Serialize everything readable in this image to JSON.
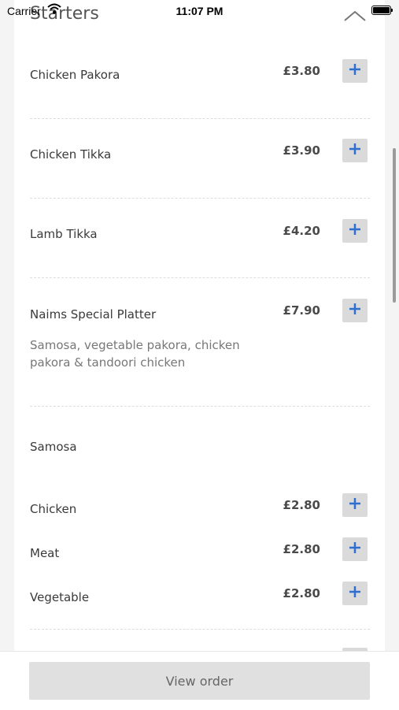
{
  "status_bar": {
    "carrier": "Carrier",
    "time": "11:07 PM"
  },
  "section": {
    "title": "Starters"
  },
  "items": [
    {
      "name": "Chicken Pakora",
      "price": "£3.80"
    },
    {
      "name": "Chicken Tikka",
      "price": "£3.90"
    },
    {
      "name": "Lamb Tikka",
      "price": "£4.20"
    },
    {
      "name": "Naims Special Platter",
      "price": "£7.90",
      "description": "Samosa, vegetable pakora, chicken pakora & tandoori chicken"
    }
  ],
  "samosa": {
    "title": "Samosa",
    "options": [
      {
        "name": "Chicken",
        "price": "£2.80"
      },
      {
        "name": "Meat",
        "price": "£2.80"
      },
      {
        "name": "Vegetable",
        "price": "£2.80"
      }
    ]
  },
  "footer": {
    "view_order_label": "View order"
  },
  "colors": {
    "accent": "#2f6fd1",
    "button_bg": "#dadada"
  }
}
